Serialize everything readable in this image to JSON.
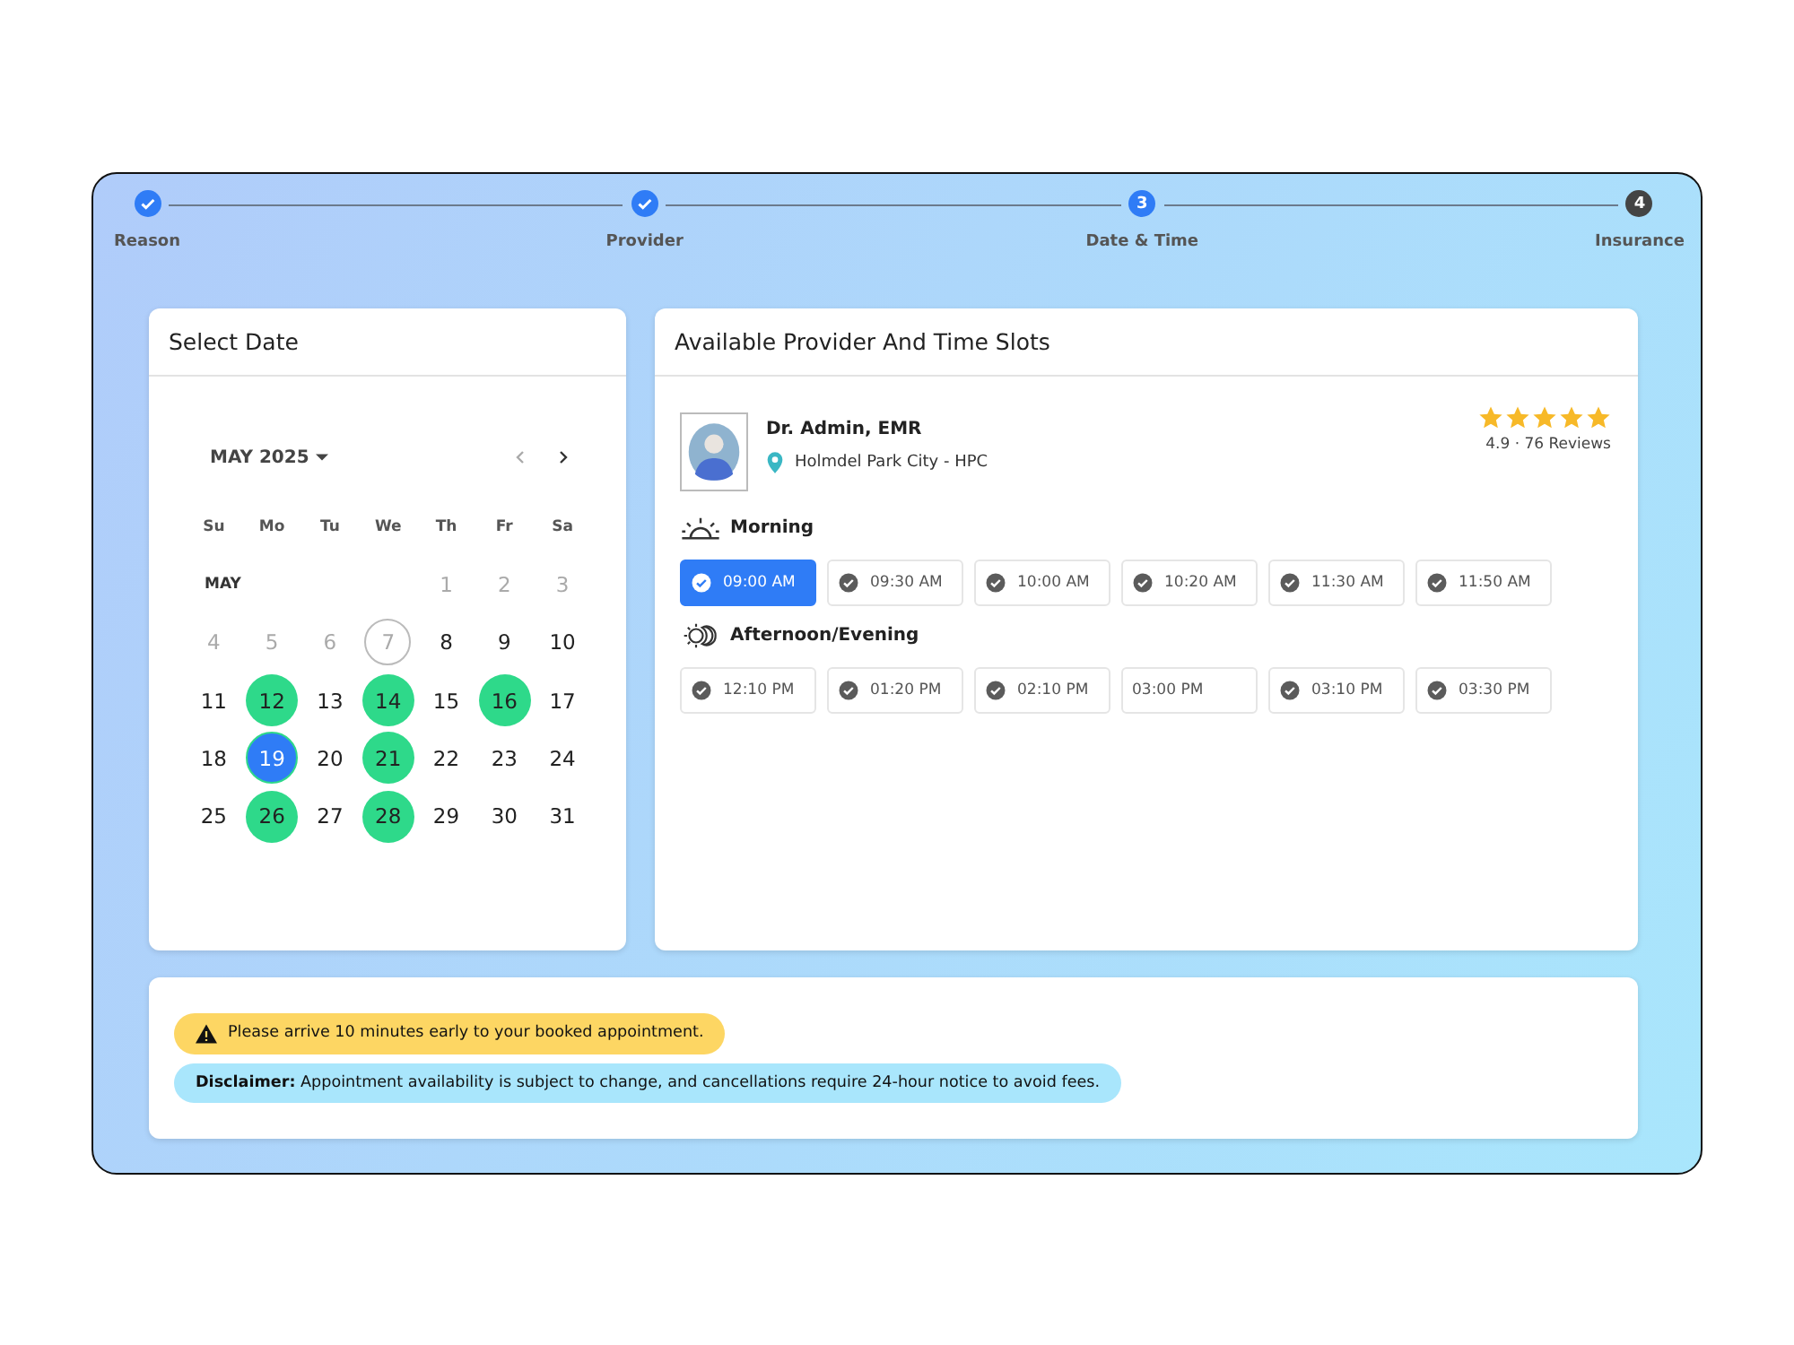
{
  "steps": [
    {
      "label": "Reason",
      "kind": "done"
    },
    {
      "label": "Provider",
      "kind": "done"
    },
    {
      "label": "Date & Time",
      "kind": "current",
      "number": "3"
    },
    {
      "label": "Insurance",
      "kind": "upcoming",
      "number": "4"
    }
  ],
  "calendar": {
    "title": "Select Date",
    "month": "MAY 2025",
    "weekdays": [
      "Su",
      "Mo",
      "Tu",
      "We",
      "Th",
      "Fr",
      "Sa"
    ],
    "weeks": [
      {
        "label": "MAY",
        "days": [
          {
            "day": "1",
            "kind": "past"
          },
          {
            "day": "2",
            "kind": "past"
          },
          {
            "day": "3",
            "kind": "past"
          }
        ]
      },
      {
        "days": [
          {
            "day": "4",
            "kind": "past"
          },
          {
            "day": "5",
            "kind": "past"
          },
          {
            "day": "6",
            "kind": "past"
          },
          {
            "day": "7",
            "kind": "today"
          },
          {
            "day": "8",
            "kind": "normal"
          },
          {
            "day": "9",
            "kind": "normal"
          },
          {
            "day": "10",
            "kind": "normal"
          }
        ]
      },
      {
        "days": [
          {
            "day": "11",
            "kind": "normal"
          },
          {
            "day": "12",
            "kind": "available"
          },
          {
            "day": "13",
            "kind": "normal"
          },
          {
            "day": "14",
            "kind": "available"
          },
          {
            "day": "15",
            "kind": "normal"
          },
          {
            "day": "16",
            "kind": "available"
          },
          {
            "day": "17",
            "kind": "normal"
          }
        ]
      },
      {
        "days": [
          {
            "day": "18",
            "kind": "normal"
          },
          {
            "day": "19",
            "kind": "selected"
          },
          {
            "day": "20",
            "kind": "normal"
          },
          {
            "day": "21",
            "kind": "available"
          },
          {
            "day": "22",
            "kind": "normal"
          },
          {
            "day": "23",
            "kind": "normal"
          },
          {
            "day": "24",
            "kind": "normal"
          }
        ]
      },
      {
        "days": [
          {
            "day": "25",
            "kind": "normal"
          },
          {
            "day": "26",
            "kind": "available"
          },
          {
            "day": "27",
            "kind": "normal"
          },
          {
            "day": "28",
            "kind": "available"
          },
          {
            "day": "29",
            "kind": "normal"
          },
          {
            "day": "30",
            "kind": "normal"
          },
          {
            "day": "31",
            "kind": "normal"
          }
        ]
      }
    ]
  },
  "slots_panel": {
    "title": "Available Provider And Time Slots",
    "provider": {
      "name": "Dr. Admin, EMR",
      "location": "Holmdel Park City - HPC",
      "stars": 5,
      "rating": "4.9 · 76 Reviews"
    },
    "sections": [
      {
        "label": "Morning",
        "kind": "sun",
        "slots": [
          {
            "time": "09:00 AM",
            "selected": true,
            "kind": "check"
          },
          {
            "time": "09:30 AM",
            "selected": false,
            "kind": "check"
          },
          {
            "time": "10:00 AM",
            "selected": false,
            "kind": "check"
          },
          {
            "time": "10:20 AM",
            "selected": false,
            "kind": "check"
          },
          {
            "time": "11:30 AM",
            "selected": false,
            "kind": "check"
          },
          {
            "time": "11:50 AM",
            "selected": false,
            "kind": "check"
          }
        ]
      },
      {
        "label": "Afternoon/Evening",
        "kind": "moon",
        "slots": [
          {
            "time": "12:10 PM",
            "selected": false,
            "kind": "check"
          },
          {
            "time": "01:20 PM",
            "selected": false,
            "kind": "check"
          },
          {
            "time": "02:10 PM",
            "selected": false,
            "kind": "check"
          },
          {
            "time": "03:00 PM",
            "selected": false,
            "kind": "plain"
          },
          {
            "time": "03:10 PM",
            "selected": false,
            "kind": "check"
          },
          {
            "time": "03:30 PM",
            "selected": false,
            "kind": "check"
          }
        ]
      }
    ]
  },
  "notices": [
    {
      "kind": "warning",
      "text": "Please arrive 10 minutes early to your booked appointment."
    },
    {
      "kind": "info",
      "text": "**Disclaimer:** Appointment availability is subject to change, and cancellations require 24-hour notice to avoid fees."
    }
  ]
}
